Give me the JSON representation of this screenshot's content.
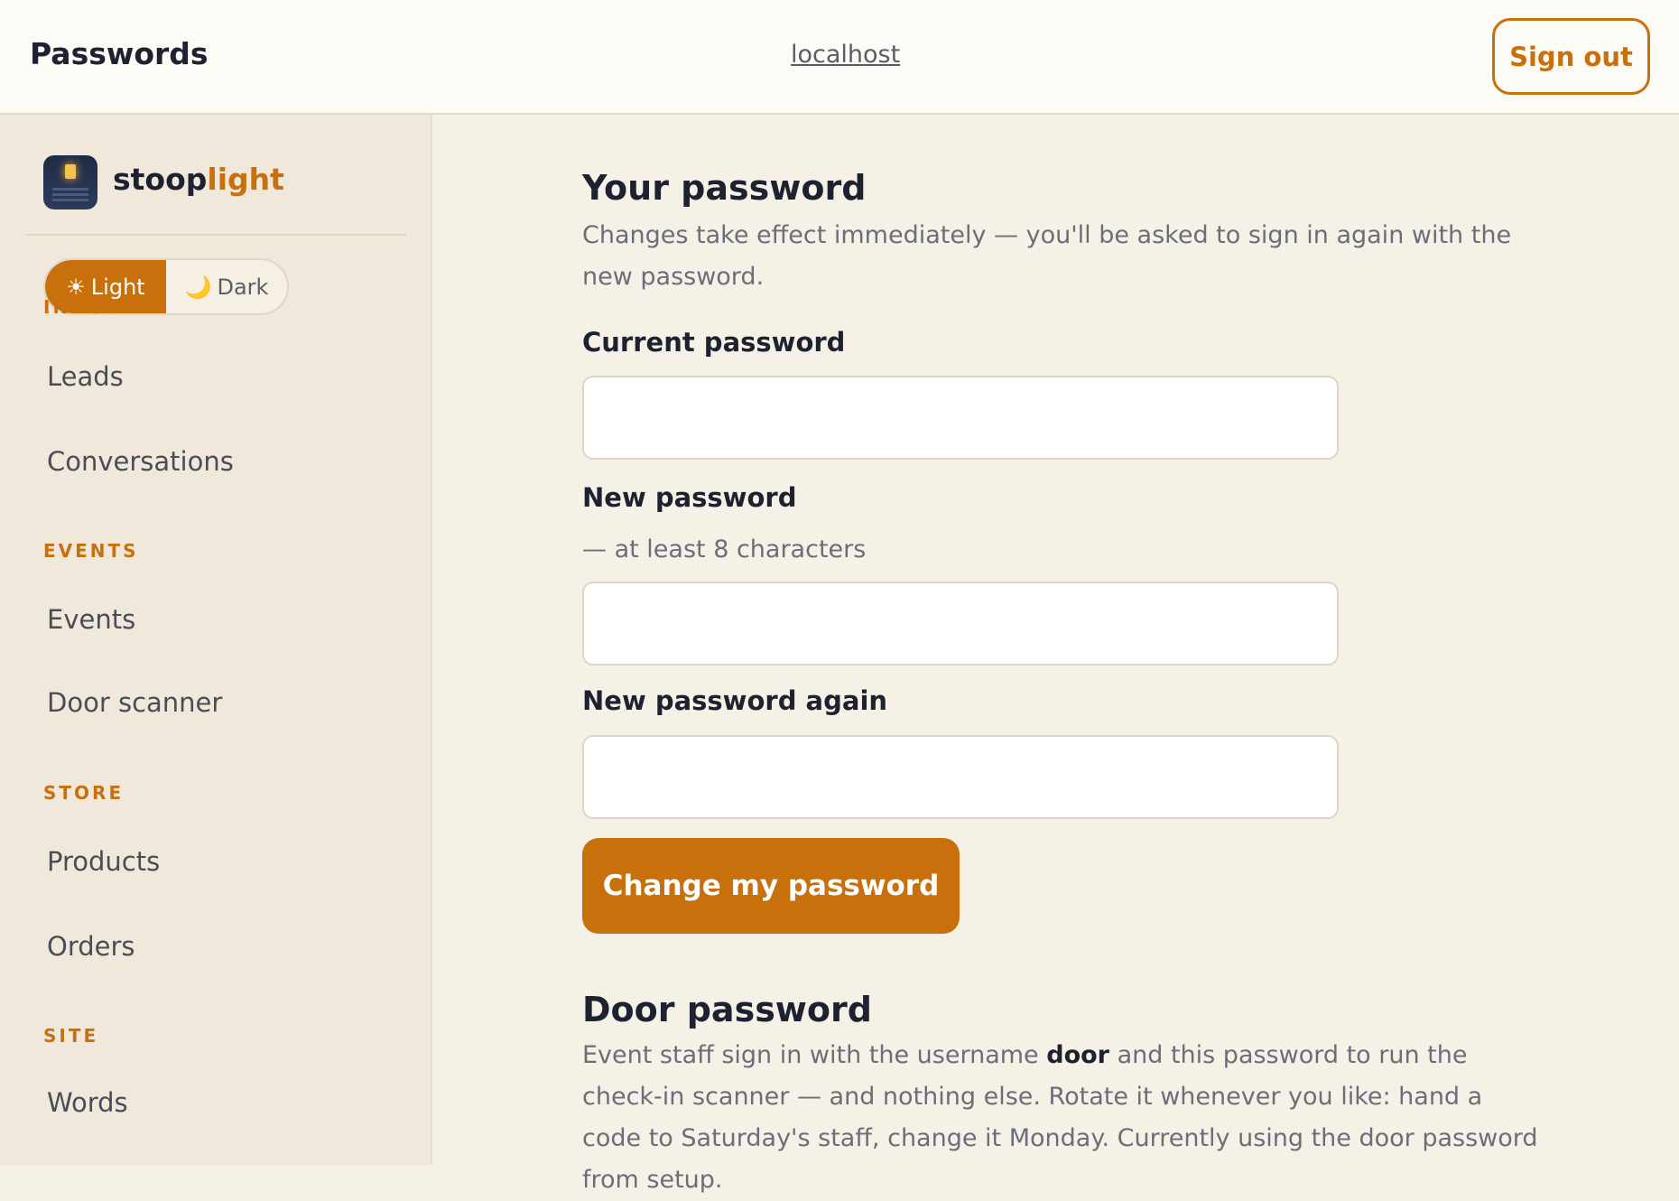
{
  "header": {
    "title": "Passwords",
    "host": "localhost",
    "sign_out": "Sign out"
  },
  "sidebar": {
    "brand_prefix": "stoop",
    "brand_accent": "light",
    "theme": {
      "light_icon": "☀",
      "light_label": "Light",
      "dark_icon": "🌙",
      "dark_label": "Dark",
      "selected": "Light"
    },
    "sections": [
      {
        "label": "INBOX",
        "items": [
          "Leads",
          "Conversations"
        ]
      },
      {
        "label": "EVENTS",
        "items": [
          "Events",
          "Door scanner"
        ]
      },
      {
        "label": "STORE",
        "items": [
          "Products",
          "Orders"
        ]
      },
      {
        "label": "SITE",
        "items": [
          "Words"
        ]
      }
    ]
  },
  "your_password": {
    "heading": "Your password",
    "description": "Changes take effect immediately — you'll be asked to sign in again with the new password.",
    "current_label": "Current password",
    "current_value": "",
    "new_label": "New password",
    "new_hint": "— at least 8 characters",
    "new_value": "",
    "again_label": "New password again",
    "again_value": "",
    "submit": "Change my password"
  },
  "door_password": {
    "heading": "Door password",
    "desc_before": "Event staff sign in with the username ",
    "desc_bold": "door",
    "desc_after": " and this password to run the check-in scanner — and nothing else. Rotate it whenever you like: hand a code to Saturday's staff, change it Monday. Currently using the door password from setup."
  },
  "colors": {
    "accent": "#c8700c",
    "page_bg": "#f6f1e7",
    "sidebar_bg": "#f0e8da"
  }
}
